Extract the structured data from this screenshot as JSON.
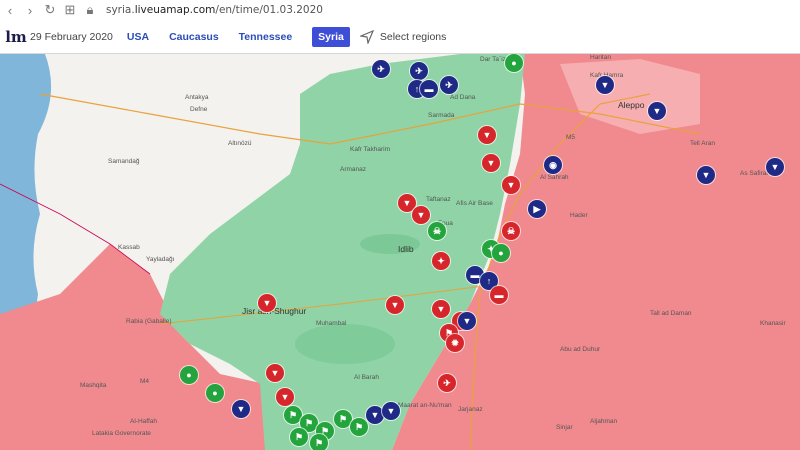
{
  "browser": {
    "url_prefix": "syria.",
    "url_domain": "liveuamap.com",
    "url_path": "/en/time/01.03.2020"
  },
  "header": {
    "logo": "lm",
    "date": "29 February 2020",
    "tabs": [
      {
        "label": "USA",
        "active": false
      },
      {
        "label": "Caucasus",
        "active": false
      },
      {
        "label": "Tennessee",
        "active": false
      },
      {
        "label": "Syria",
        "active": true
      }
    ],
    "select_regions": "Select regions"
  },
  "map": {
    "colors": {
      "sea": "#7fb6d9",
      "turkey": "#f4f2ee",
      "rebel": "#8fd3a6",
      "government": "#f08a8e",
      "turkish_held": "#f8b7b9"
    },
    "labels": {
      "antakya": "Antakya",
      "defne": "Defne",
      "altinozu": "Altınözü",
      "samandag": "Samandağ",
      "yayladagi": "Yayladağı",
      "kassab": "Kassab",
      "rabia": "Rabia (Gaballe)",
      "mashqita": "Mashqita",
      "al_haffah": "Al-Haffah",
      "latakia": "Latakia Governorate",
      "dar_ta_izzah": "Dar Ta`izzah",
      "ad_dana": "Ad Dana",
      "sarmada": "Sarmada",
      "kafr_takharim": "Kafr Takharim",
      "armanaz": "Armanaz",
      "taftanaz": "Taftanaz",
      "foua": "Foua",
      "afis": "Afis Air Base",
      "idlib": "Idlib",
      "jisr_ash_shughur": "Jisr ash-Shughur",
      "muhambal": "Muhambal",
      "al_barah": "Al Barah",
      "maarat": "Maarat an-Nu'man",
      "jarjanaz": "Jarjanaz",
      "sinjar": "Sinjar",
      "aljahman": "Aljahman",
      "abu_ad_duhur": "Abu ad Duhur",
      "tall_ad_daman": "Tall ad Daman",
      "khanasir": "Khanasir",
      "hadir": "Hader",
      "as_safirah": "As Safirah",
      "tell_aran": "Tell Aran",
      "al_sahrah": "Al Sahrah",
      "aleppo": "Aleppo",
      "kafr_hamra": "Kafr Hamra",
      "haritan": "Haritan",
      "m5": "M5",
      "m4": "M4"
    }
  }
}
